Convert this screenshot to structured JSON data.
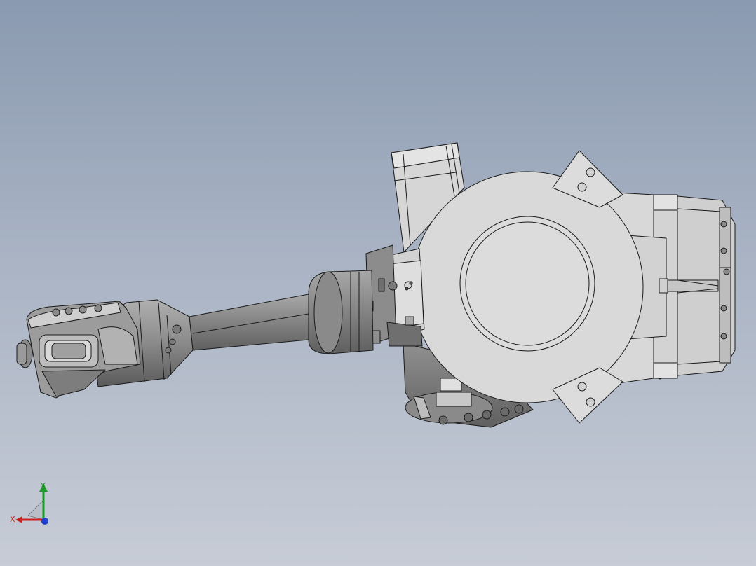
{
  "viewport": {
    "background_top": "#8a9ab0",
    "background_bottom": "#c7ccd6"
  },
  "model": {
    "shade_light": "#d9d9d9",
    "shade_dark": "#7a7a7a",
    "edge_color": "#1a1a1a"
  },
  "triad": {
    "x_label": "X",
    "y_label": "Y",
    "x_color": "#cc1f1f",
    "y_color": "#1f9a2a",
    "z_color": "#1f3fcc"
  }
}
